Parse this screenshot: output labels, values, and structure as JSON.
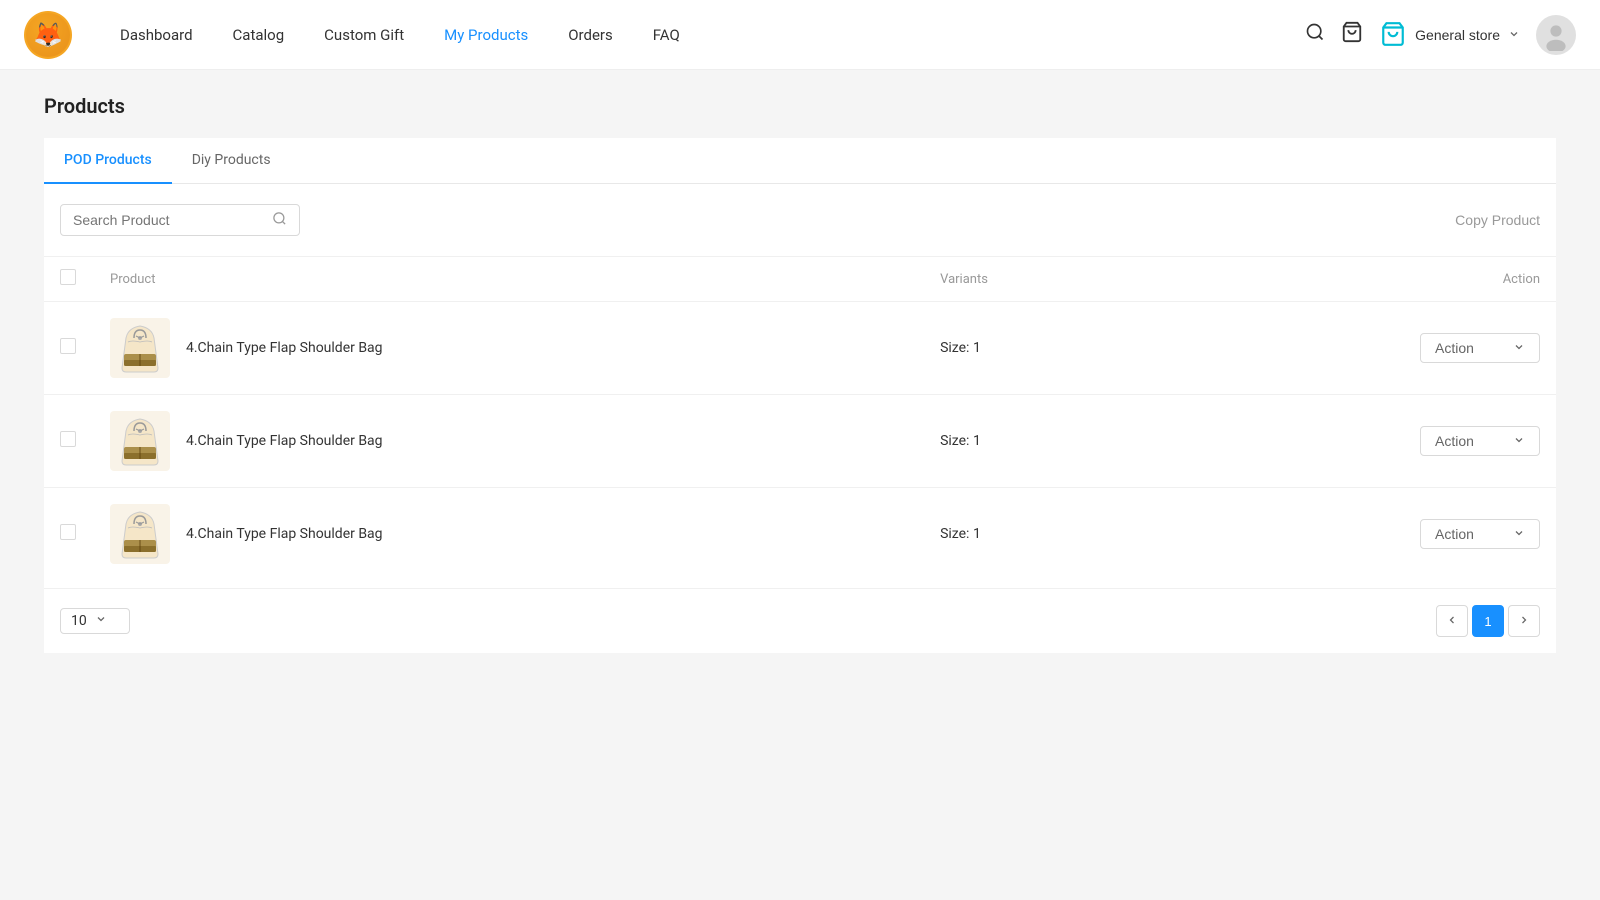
{
  "header": {
    "logo_emoji": "🦊",
    "nav_items": [
      {
        "label": "Dashboard",
        "active": false
      },
      {
        "label": "Catalog",
        "active": false
      },
      {
        "label": "Custom Gift",
        "active": false
      },
      {
        "label": "My Products",
        "active": true
      },
      {
        "label": "Orders",
        "active": false
      },
      {
        "label": "FAQ",
        "active": false
      }
    ],
    "store_label": "General store",
    "search_icon": "🔍",
    "cart_icon": "🛒",
    "store_icon": "🛍️",
    "avatar_icon": "👤"
  },
  "page": {
    "title": "Products"
  },
  "tabs": [
    {
      "label": "POD Products",
      "active": true
    },
    {
      "label": "Diy Products",
      "active": false
    }
  ],
  "toolbar": {
    "search_placeholder": "Search Product",
    "copy_product_label": "Copy Product"
  },
  "table": {
    "columns": [
      {
        "label": "",
        "key": "checkbox"
      },
      {
        "label": "Product",
        "key": "product"
      },
      {
        "label": "Variants",
        "key": "variants"
      },
      {
        "label": "Action",
        "key": "action"
      }
    ],
    "rows": [
      {
        "id": 1,
        "product_name": "4.Chain Type Flap Shoulder Bag",
        "variants_label": "Size:",
        "variants_value": "1",
        "action_label": "Action"
      },
      {
        "id": 2,
        "product_name": "4.Chain Type Flap Shoulder Bag",
        "variants_label": "Size:",
        "variants_value": "1",
        "action_label": "Action"
      },
      {
        "id": 3,
        "product_name": "4.Chain Type Flap Shoulder Bag",
        "variants_label": "Size:",
        "variants_value": "1",
        "action_label": "Action"
      }
    ]
  },
  "pagination": {
    "page_size": "10",
    "current_page": 1,
    "prev_label": "<",
    "next_label": ">"
  }
}
